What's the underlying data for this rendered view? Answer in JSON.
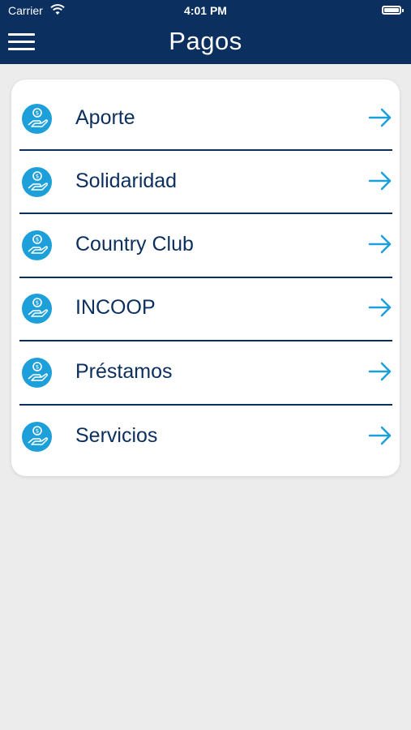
{
  "status_bar": {
    "carrier": "Carrier",
    "time": "4:01 PM"
  },
  "header": {
    "title": "Pagos",
    "menu_icon": "hamburger-menu-icon"
  },
  "payment_items": [
    {
      "label": "Aporte",
      "icon": "hand-coin-icon",
      "action_icon": "arrow-right-icon"
    },
    {
      "label": "Solidaridad",
      "icon": "hand-coin-icon",
      "action_icon": "arrow-right-icon"
    },
    {
      "label": "Country Club",
      "icon": "hand-coin-icon",
      "action_icon": "arrow-right-icon"
    },
    {
      "label": "INCOOP",
      "icon": "hand-coin-icon",
      "action_icon": "arrow-right-icon"
    },
    {
      "label": "Préstamos",
      "icon": "hand-coin-icon",
      "action_icon": "arrow-right-icon"
    },
    {
      "label": "Servicios",
      "icon": "hand-coin-icon",
      "action_icon": "arrow-right-icon"
    }
  ],
  "colors": {
    "header": "#0b2f5e",
    "accent": "#1d9fd9",
    "text": "#0b2f5e",
    "background": "#ececec"
  }
}
